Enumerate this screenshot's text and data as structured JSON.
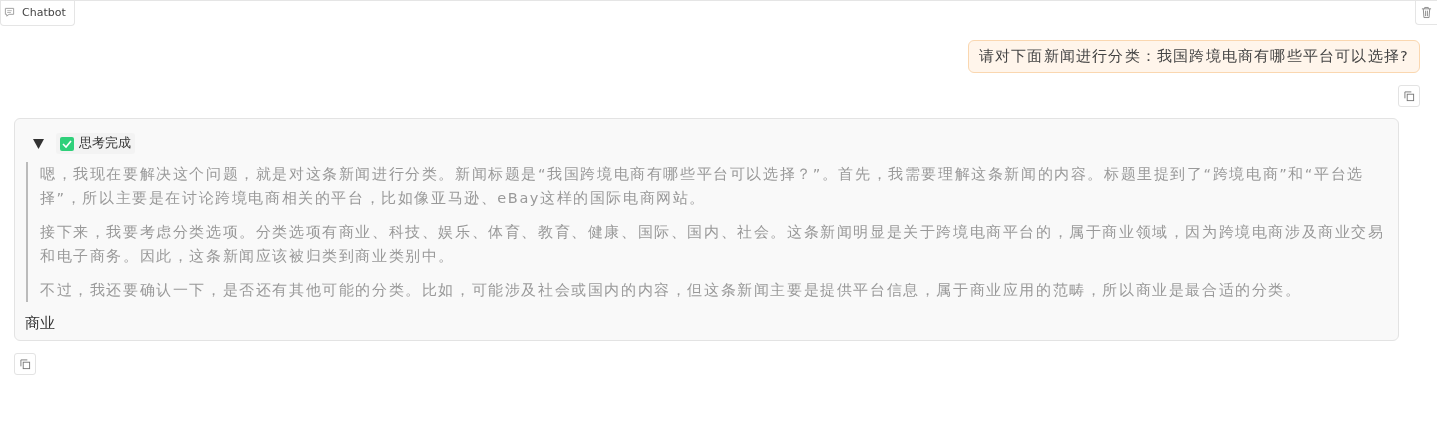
{
  "tab": {
    "label": "Chatbot"
  },
  "messages": [
    {
      "kind": "user",
      "text": "请对下面新闻进行分类：我国跨境电商有哪些平台可以选择?"
    },
    {
      "kind": "bot",
      "thinking": {
        "expanded": true,
        "done": true,
        "status": "思考完成",
        "paragraphs": [
          "嗯，我现在要解决这个问题，就是对这条新闻进行分类。新闻标题是“我国跨境电商有哪些平台可以选择？”。首先，我需要理解这条新闻的内容。标题里提到了“跨境电商”和“平台选择”，所以主要是在讨论跨境电商相关的平台，比如像亚马逊、eBay这样的国际电商网站。",
          "接下来，我要考虑分类选项。分类选项有商业、科技、娱乐、体育、教育、健康、国际、国内、社会。这条新闻明显是关于跨境电商平台的，属于商业领域，因为跨境电商涉及商业交易和电子商务。因此，这条新闻应该被归类到商业类别中。",
          "不过，我还要确认一下，是否还有其他可能的分类。比如，可能涉及社会或国内的内容，但这条新闻主要是提供平台信息，属于商业应用的范畴，所以商业是最合适的分类。"
        ]
      },
      "text": "商业"
    }
  ]
}
